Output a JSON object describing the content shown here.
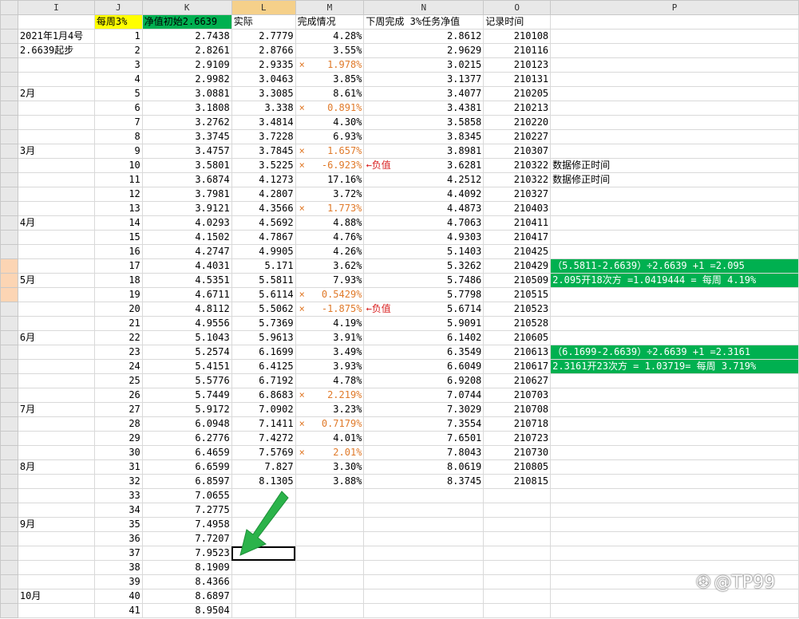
{
  "columns": [
    "I",
    "J",
    "K",
    "L",
    "M",
    "N",
    "O",
    "P"
  ],
  "headers": {
    "J": "每周3%",
    "K": "净值初始2.6639",
    "L": "实际",
    "M": "完成情况",
    "N": "下周完成 3%任务净值",
    "O": "记录时间"
  },
  "rows": [
    {
      "I": "2021年1月4号",
      "J": "1",
      "K": "2.7438",
      "L": "2.7779",
      "Mx": "",
      "M": "4.28%",
      "Mred": "",
      "N": "2.8612",
      "O": "210108",
      "P": ""
    },
    {
      "I": "2.6639起步",
      "J": "2",
      "K": "2.8261",
      "L": "2.8766",
      "Mx": "",
      "M": "3.55%",
      "Mred": "",
      "N": "2.9629",
      "O": "210116",
      "P": ""
    },
    {
      "I": "",
      "J": "3",
      "K": "2.9109",
      "L": "2.9335",
      "Mx": "×",
      "M": "1.978%",
      "Mred": "",
      "N": "3.0215",
      "O": "210123",
      "P": ""
    },
    {
      "I": "",
      "J": "4",
      "K": "2.9982",
      "L": "3.0463",
      "Mx": "",
      "M": "3.85%",
      "Mred": "",
      "N": "3.1377",
      "O": "210131",
      "P": ""
    },
    {
      "I": "2月",
      "J": "5",
      "K": "3.0881",
      "L": "3.3085",
      "Mx": "",
      "M": "8.61%",
      "Mred": "",
      "N": "3.4077",
      "O": "210205",
      "P": ""
    },
    {
      "I": "",
      "J": "6",
      "K": "3.1808",
      "L": "3.338",
      "Mx": "×",
      "M": "0.891%",
      "Mred": "",
      "N": "3.4381",
      "O": "210213",
      "P": ""
    },
    {
      "I": "",
      "J": "7",
      "K": "3.2762",
      "L": "3.4814",
      "Mx": "",
      "M": "4.30%",
      "Mred": "",
      "N": "3.5858",
      "O": "210220",
      "P": ""
    },
    {
      "I": "",
      "J": "8",
      "K": "3.3745",
      "L": "3.7228",
      "Mx": "",
      "M": "6.93%",
      "Mred": "",
      "N": "3.8345",
      "O": "210227",
      "P": ""
    },
    {
      "I": "3月",
      "J": "9",
      "K": "3.4757",
      "L": "3.7845",
      "Mx": "×",
      "M": "1.657%",
      "Mred": "",
      "N": "3.8981",
      "O": "210307",
      "P": ""
    },
    {
      "I": "",
      "J": "10",
      "K": "3.5801",
      "L": "3.5225",
      "Mx": "×",
      "M": "-6.923%",
      "Mred": "←负值",
      "N": "3.6281",
      "O": "210322",
      "P": "数据修正时间"
    },
    {
      "I": "",
      "J": "11",
      "K": "3.6874",
      "L": "4.1273",
      "Mx": "",
      "M": "17.16%",
      "Mred": "",
      "N": "4.2512",
      "O": "210322",
      "P": "数据修正时间"
    },
    {
      "I": "",
      "J": "12",
      "K": "3.7981",
      "L": "4.2807",
      "Mx": "",
      "M": "3.72%",
      "Mred": "",
      "N": "4.4092",
      "O": "210327",
      "P": ""
    },
    {
      "I": "",
      "J": "13",
      "K": "3.9121",
      "L": "4.3566",
      "Mx": "×",
      "M": "1.773%",
      "Mred": "",
      "N": "4.4873",
      "O": "210403",
      "P": ""
    },
    {
      "I": "4月",
      "J": "14",
      "K": "4.0293",
      "L": "4.5692",
      "Mx": "",
      "M": "4.88%",
      "Mred": "",
      "N": "4.7063",
      "O": "210411",
      "P": ""
    },
    {
      "I": "",
      "J": "15",
      "K": "4.1502",
      "L": "4.7867",
      "Mx": "",
      "M": "4.76%",
      "Mred": "",
      "N": "4.9303",
      "O": "210417",
      "P": ""
    },
    {
      "I": "",
      "J": "16",
      "K": "4.2747",
      "L": "4.9905",
      "Mx": "",
      "M": "4.26%",
      "Mred": "",
      "N": "5.1403",
      "O": "210425",
      "P": ""
    },
    {
      "I": "",
      "J": "17",
      "K": "4.4031",
      "L": "5.171",
      "Mx": "",
      "M": "3.62%",
      "Mred": "",
      "N": "5.3262",
      "O": "210429",
      "P": "（5.5811-2.6639）÷2.6639 +1 =2.095",
      "Pg": true
    },
    {
      "I": "5月",
      "J": "18",
      "K": "4.5351",
      "L": "5.5811",
      "Mx": "",
      "M": "7.93%",
      "Mred": "",
      "N": "5.7486",
      "O": "210509",
      "P": "2.095开18次方 =1.0419444 = 每周 4.19%",
      "Pg": true
    },
    {
      "I": "",
      "J": "19",
      "K": "4.6711",
      "L": "5.6114",
      "Mx": "×",
      "M": "0.5429%",
      "Mred": "",
      "N": "5.7798",
      "O": "210515",
      "P": ""
    },
    {
      "I": "",
      "J": "20",
      "K": "4.8112",
      "L": "5.5062",
      "Mx": "×",
      "M": "-1.875%",
      "Mred": "←负值",
      "N": "5.6714",
      "O": "210523",
      "P": ""
    },
    {
      "I": "",
      "J": "21",
      "K": "4.9556",
      "L": "5.7369",
      "Mx": "",
      "M": "4.19%",
      "Mred": "",
      "N": "5.9091",
      "O": "210528",
      "P": ""
    },
    {
      "I": "6月",
      "J": "22",
      "K": "5.1043",
      "L": "5.9613",
      "Mx": "",
      "M": "3.91%",
      "Mred": "",
      "N": "6.1402",
      "O": "210605",
      "P": ""
    },
    {
      "I": "",
      "J": "23",
      "K": "5.2574",
      "L": "6.1699",
      "Mx": "",
      "M": "3.49%",
      "Mred": "",
      "N": "6.3549",
      "O": "210613",
      "P": "（6.1699-2.6639）÷2.6639 +1 =2.3161",
      "Pg": true
    },
    {
      "I": "",
      "J": "24",
      "K": "5.4151",
      "L": "6.4125",
      "Mx": "",
      "M": "3.93%",
      "Mred": "",
      "N": "6.6049",
      "O": "210617",
      "P": "2.3161开23次方 = 1.03719= 每周 3.719%",
      "Pg": true
    },
    {
      "I": "",
      "J": "25",
      "K": "5.5776",
      "L": "6.7192",
      "Mx": "",
      "M": "4.78%",
      "Mred": "",
      "N": "6.9208",
      "O": "210627",
      "P": ""
    },
    {
      "I": "",
      "J": "26",
      "K": "5.7449",
      "L": "6.8683",
      "Mx": "×",
      "M": "2.219%",
      "Mred": "",
      "N": "7.0744",
      "O": "210703",
      "P": ""
    },
    {
      "I": "7月",
      "J": "27",
      "K": "5.9172",
      "L": "7.0902",
      "Mx": "",
      "M": "3.23%",
      "Mred": "",
      "N": "7.3029",
      "O": "210708",
      "P": ""
    },
    {
      "I": "",
      "J": "28",
      "K": "6.0948",
      "L": "7.1411",
      "Mx": "×",
      "M": "0.7179%",
      "Mred": "",
      "N": "7.3554",
      "O": "210718",
      "P": ""
    },
    {
      "I": "",
      "J": "29",
      "K": "6.2776",
      "L": "7.4272",
      "Mx": "",
      "M": "4.01%",
      "Mred": "",
      "N": "7.6501",
      "O": "210723",
      "P": ""
    },
    {
      "I": "",
      "J": "30",
      "K": "6.4659",
      "L": "7.5769",
      "Mx": "×",
      "M": "2.01%",
      "Mred": "",
      "N": "7.8043",
      "O": "210730",
      "P": ""
    },
    {
      "I": "8月",
      "J": "31",
      "K": "6.6599",
      "L": "7.827",
      "Mx": "",
      "M": "3.30%",
      "Mred": "",
      "N": "8.0619",
      "O": "210805",
      "P": ""
    },
    {
      "I": "",
      "J": "32",
      "K": "6.8597",
      "L": "8.1305",
      "Mx": "",
      "M": "3.88%",
      "Mred": "",
      "N": "8.3745",
      "O": "210815",
      "P": ""
    },
    {
      "I": "",
      "J": "33",
      "K": "7.0655",
      "L": "",
      "Mx": "",
      "M": "",
      "Mred": "",
      "N": "",
      "O": "",
      "P": ""
    },
    {
      "I": "",
      "J": "34",
      "K": "7.2775",
      "L": "",
      "Mx": "",
      "M": "",
      "Mred": "",
      "N": "",
      "O": "",
      "P": ""
    },
    {
      "I": "9月",
      "J": "35",
      "K": "7.4958",
      "L": "",
      "Mx": "",
      "M": "",
      "Mred": "",
      "N": "",
      "O": "",
      "P": ""
    },
    {
      "I": "",
      "J": "36",
      "K": "7.7207",
      "L": "",
      "Mx": "",
      "M": "",
      "Mred": "",
      "N": "",
      "O": "",
      "P": ""
    },
    {
      "I": "",
      "J": "37",
      "K": "7.9523",
      "L": "",
      "Mx": "",
      "M": "",
      "Mred": "",
      "N": "",
      "O": "",
      "P": "",
      "selL": true
    },
    {
      "I": "",
      "J": "38",
      "K": "8.1909",
      "L": "",
      "Mx": "",
      "M": "",
      "Mred": "",
      "N": "",
      "O": "",
      "P": ""
    },
    {
      "I": "",
      "J": "39",
      "K": "8.4366",
      "L": "",
      "Mx": "",
      "M": "",
      "Mred": "",
      "N": "",
      "O": "",
      "P": ""
    },
    {
      "I": "10月",
      "J": "40",
      "K": "8.6897",
      "L": "",
      "Mx": "",
      "M": "",
      "Mred": "",
      "N": "",
      "O": "",
      "P": ""
    },
    {
      "I": "",
      "J": "41",
      "K": "8.9504",
      "L": "",
      "Mx": "",
      "M": "",
      "Mred": "",
      "N": "",
      "O": "",
      "P": ""
    }
  ],
  "watermark": {
    "icon": "weibo-logo-icon",
    "text": "@TP99"
  },
  "colors": {
    "accent_green": "#00b050",
    "header_yellow": "#ffff00",
    "x_orange": "#e07a2a",
    "negative_red": "#d81e1e"
  }
}
